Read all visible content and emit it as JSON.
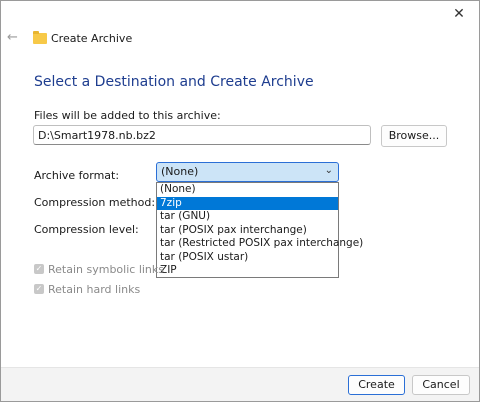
{
  "window": {
    "title": "Create Archive",
    "close_icon": "close-icon",
    "back_icon": "back-arrow-icon",
    "folder_icon": "archive-folder-icon"
  },
  "heading": "Select a Destination and Create Archive",
  "destination": {
    "label": "Files will be added to this archive:",
    "value": "D:\\Smart1978.nb.bz2",
    "browse_label": "Browse..."
  },
  "format": {
    "label": "Archive format:",
    "selected": "(None)",
    "options": [
      "(None)",
      "7zip",
      "tar (GNU)",
      "tar (POSIX pax interchange)",
      "tar (Restricted POSIX pax interchange)",
      "tar (POSIX ustar)",
      "ZIP"
    ],
    "highlighted_index": 1
  },
  "compression_method_label": "Compression method:",
  "compression_level_label": "Compression level:",
  "options": {
    "retain_symbolic_links": "Retain symbolic links",
    "retain_hard_links": "Retain hard links"
  },
  "buttons": {
    "create": "Create",
    "cancel": "Cancel"
  },
  "colors": {
    "heading": "#1e3d8f",
    "accent": "#0078d7",
    "select_bg": "#cce4f7"
  }
}
